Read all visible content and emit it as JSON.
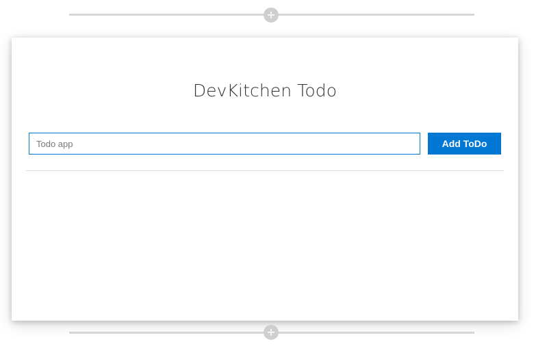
{
  "app": {
    "title": "DevKitchen Todo"
  },
  "todo_form": {
    "input_value": "",
    "input_placeholder": "Todo app",
    "add_button_label": "Add ToDo"
  },
  "todo_list": {
    "items": []
  },
  "colors": {
    "accent": "#0078d4",
    "divider": "#d6d6d6"
  },
  "icons": {
    "add_section": "plus-circle-icon"
  }
}
